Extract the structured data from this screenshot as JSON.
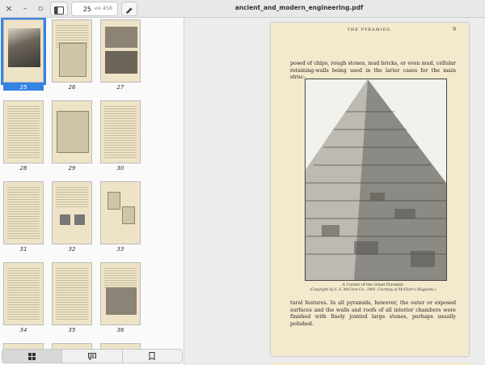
{
  "toolbar": {
    "close_icon": "×",
    "minimize_icon": "–",
    "maximize_icon": "▫",
    "sidebar_icon": "sidebar-icon",
    "page_current": "25",
    "page_total": "из 458",
    "edit_icon": "pencil-icon",
    "title": "ancient_and_modern_engineering.pdf"
  },
  "thumbnails": [
    {
      "label": "25",
      "selected": true
    },
    {
      "label": "26"
    },
    {
      "label": "27"
    },
    {
      "label": "28"
    },
    {
      "label": "29"
    },
    {
      "label": "30"
    },
    {
      "label": "31"
    },
    {
      "label": "32"
    },
    {
      "label": "33"
    },
    {
      "label": "34"
    },
    {
      "label": "35"
    },
    {
      "label": "36"
    }
  ],
  "sidebar_tabs": [
    "thumbnails-icon",
    "annotations-icon",
    "bookmarks-icon"
  ],
  "page": {
    "running_head": "THE PYRAMIDS.",
    "number": "9",
    "para_top": "posed of chips, rough stones, mud bricks, or even mud, cellular retaining-walls being used in the latter cases for the main struc-",
    "caption_title": "A Corner of the Great Pyramid.",
    "caption_credit": "(Copyright by S. S. McClure Co., 1901.  Courtesy of McClure's Magazine.)",
    "para_bottom": "tural features.  In all pyramids, however, the outer or exposed surfaces and the walls and roofs of all interior chambers were finished with finely jointed large stones, perhaps usually polished."
  },
  "colors": {
    "accent": "#3584e4",
    "paper": "#f3e9cc"
  }
}
